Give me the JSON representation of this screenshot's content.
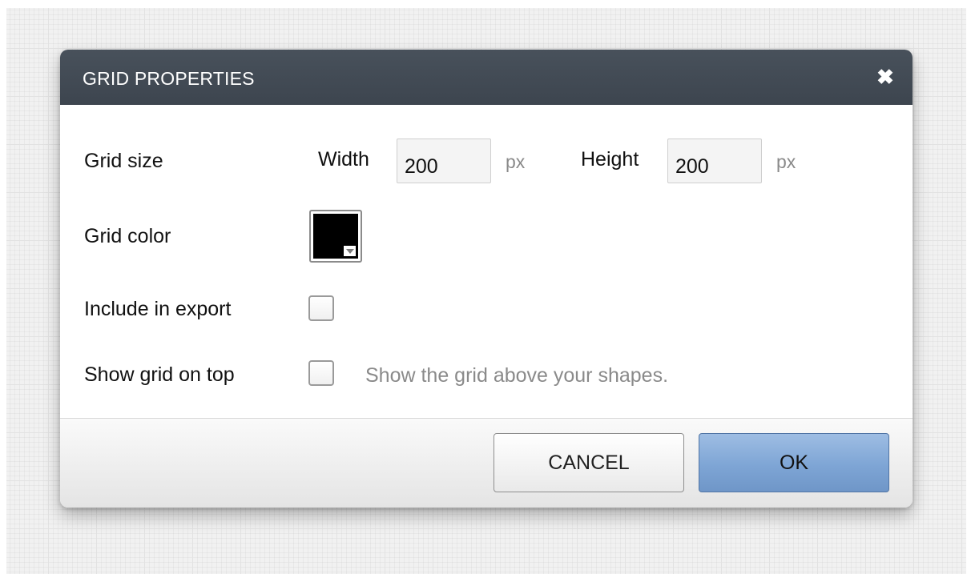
{
  "dialog": {
    "title": "GRID PROPERTIES",
    "close_icon": "close-icon",
    "close_glyph": "✖"
  },
  "grid_size": {
    "label": "Grid size",
    "width_label": "Width",
    "width_value": "200",
    "width_unit": "px",
    "height_label": "Height",
    "height_value": "200",
    "height_unit": "px"
  },
  "grid_color": {
    "label": "Grid color",
    "color": "#000000"
  },
  "include_in_export": {
    "label": "Include in export",
    "checked": false
  },
  "show_grid_on_top": {
    "label": "Show grid on top",
    "checked": false,
    "hint": "Show the grid above your shapes."
  },
  "buttons": {
    "cancel": "CANCEL",
    "ok": "OK"
  },
  "colors": {
    "titlebar": "#434b55",
    "ok_button": "#7ea5d5",
    "background": "#f1f1f1"
  }
}
